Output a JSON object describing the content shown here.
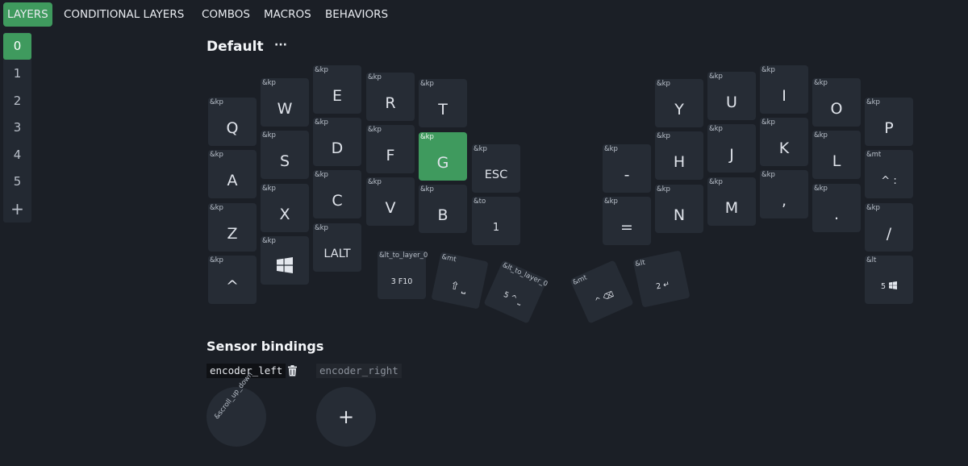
{
  "tabs": [
    {
      "label": "LAYERS",
      "active": true
    },
    {
      "label": "CONDITIONAL LAYERS"
    },
    {
      "label": "COMBOS"
    },
    {
      "label": "MACROS"
    },
    {
      "label": "BEHAVIORS"
    }
  ],
  "layers": {
    "items": [
      "0",
      "1",
      "2",
      "3",
      "4",
      "5"
    ],
    "active_index": 0,
    "add_label": "+"
  },
  "layer_title": "Default",
  "menu_label": "···",
  "keys": [
    {
      "behavior": "&kp",
      "label": "Q"
    },
    {
      "behavior": "&kp",
      "label": "W"
    },
    {
      "behavior": "&kp",
      "label": "E"
    },
    {
      "behavior": "&kp",
      "label": "R"
    },
    {
      "behavior": "&kp",
      "label": "T"
    },
    {
      "behavior": "&kp",
      "label": "Y"
    },
    {
      "behavior": "&kp",
      "label": "U"
    },
    {
      "behavior": "&kp",
      "label": "I"
    },
    {
      "behavior": "&kp",
      "label": "O"
    },
    {
      "behavior": "&kp",
      "label": "P"
    },
    {
      "behavior": "&kp",
      "label": "A"
    },
    {
      "behavior": "&kp",
      "label": "S"
    },
    {
      "behavior": "&kp",
      "label": "D"
    },
    {
      "behavior": "&kp",
      "label": "F"
    },
    {
      "behavior": "&kp",
      "label": "G",
      "selected": true
    },
    {
      "behavior": "&kp",
      "label": "ESC"
    },
    {
      "behavior": "&kp",
      "label": "-"
    },
    {
      "behavior": "&kp",
      "label": "H"
    },
    {
      "behavior": "&kp",
      "label": "J"
    },
    {
      "behavior": "&kp",
      "label": "K"
    },
    {
      "behavior": "&kp",
      "label": "L"
    },
    {
      "behavior": "&mt",
      "label": "^ :"
    },
    {
      "behavior": "&kp",
      "label": "Z"
    },
    {
      "behavior": "&kp",
      "label": "X"
    },
    {
      "behavior": "&kp",
      "label": "C"
    },
    {
      "behavior": "&kp",
      "label": "V"
    },
    {
      "behavior": "&kp",
      "label": "B"
    },
    {
      "behavior": "&to",
      "label": "1"
    },
    {
      "behavior": "&kp",
      "label": "="
    },
    {
      "behavior": "&kp",
      "label": "N"
    },
    {
      "behavior": "&kp",
      "label": "M"
    },
    {
      "behavior": "&kp",
      "label": ","
    },
    {
      "behavior": "&kp",
      "label": "."
    },
    {
      "behavior": "&kp",
      "label": "/"
    },
    {
      "behavior": "&kp",
      "label": "^"
    },
    {
      "behavior": "&kp",
      "label": "",
      "icon": "windows-icon"
    },
    {
      "behavior": "&kp",
      "label": "LALT"
    },
    {
      "behavior": "&lt_to_layer_0",
      "label": "3 F10"
    },
    {
      "behavior": "&mt",
      "label": "⇧ ⎵"
    },
    {
      "behavior": "&lt_to_layer_0",
      "label": "5 ^ ⎵"
    },
    {
      "behavior": "&mt",
      "label": "^ ⌫"
    },
    {
      "behavior": "&lt",
      "label": "2 ↵"
    },
    {
      "behavior": "&lt",
      "label": "5",
      "icon": "windows-icon"
    }
  ],
  "sensor": {
    "title": "Sensor bindings",
    "encoders": [
      {
        "label": "encoder_left",
        "active": true
      },
      {
        "label": "encoder_right",
        "active": false
      }
    ],
    "left_binding": "&scroll_up_down",
    "add_label": "+"
  },
  "colors": {
    "accent": "#3f9a5e",
    "background": "#1b1f26",
    "key": "#262c35"
  }
}
